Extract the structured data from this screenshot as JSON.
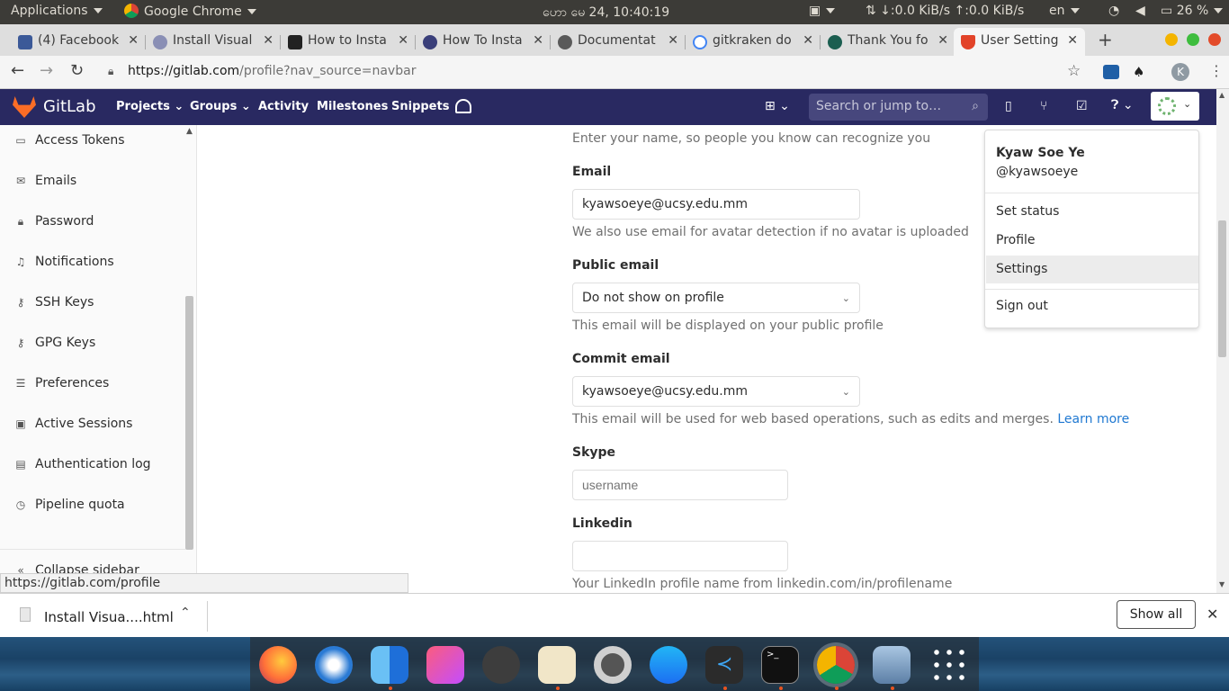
{
  "os_bar": {
    "applications": "Applications",
    "active_app": "Google Chrome",
    "clock": "ဟော မေ 24, 10:40:19",
    "network": "⇅ ↓:0.0 KiB/s ↑:0.0 KiB/s",
    "language": "en",
    "battery": "26 %"
  },
  "browser": {
    "tabs": [
      {
        "label": "(4) Facebook",
        "color": "#3b5998"
      },
      {
        "label": "Install Visual",
        "color": "#8a8fb5"
      },
      {
        "label": "How to Insta",
        "color": "#222222"
      },
      {
        "label": "How To Insta",
        "color": "#3a3f7a"
      },
      {
        "label": "Documentat",
        "color": "#5a5a5a"
      },
      {
        "label": "gitkraken do",
        "color": "#4285f4"
      },
      {
        "label": "Thank You fo",
        "color": "#1b5e50"
      },
      {
        "label": "User Setting",
        "color": "#e24329"
      }
    ],
    "url_host": "https://gitlab.com",
    "url_path": "/profile?nav_source=navbar",
    "profile_initial": "K"
  },
  "gitlab_header": {
    "brand": "GitLab",
    "nav": [
      "Projects",
      "Groups",
      "Activity",
      "Milestones",
      "Snippets"
    ],
    "search_placeholder": "Search or jump to…"
  },
  "sidebar": {
    "items": [
      {
        "label": "Access Tokens",
        "icon": "token-icon"
      },
      {
        "label": "Emails",
        "icon": "mail-icon"
      },
      {
        "label": "Password",
        "icon": "lock-icon"
      },
      {
        "label": "Notifications",
        "icon": "bell-icon"
      },
      {
        "label": "SSH Keys",
        "icon": "key-icon"
      },
      {
        "label": "GPG Keys",
        "icon": "key-icon"
      },
      {
        "label": "Preferences",
        "icon": "sliders-icon"
      },
      {
        "label": "Active Sessions",
        "icon": "monitor-icon"
      },
      {
        "label": "Authentication log",
        "icon": "log-icon"
      },
      {
        "label": "Pipeline quota",
        "icon": "quota-icon"
      }
    ],
    "collapse": "Collapse sidebar"
  },
  "form": {
    "name_help": "Enter your name, so people you know can recognize you",
    "email_label": "Email",
    "email_value": "kyawsoeye@ucsy.edu.mm",
    "email_help": "We also use email for avatar detection if no avatar is uploaded",
    "public_email_label": "Public email",
    "public_email_value": "Do not show on profile",
    "public_email_help": "This email will be displayed on your public profile",
    "commit_email_label": "Commit email",
    "commit_email_value": "kyawsoeye@ucsy.edu.mm",
    "commit_email_help": "This email will be used for web based operations, such as edits and merges.",
    "learn_more": "Learn more",
    "skype_label": "Skype",
    "skype_placeholder": "username",
    "linkedin_label": "Linkedin",
    "linkedin_help": "Your LinkedIn profile name from linkedin.com/in/profilename"
  },
  "user_menu": {
    "name": "Kyaw Soe Ye",
    "handle": "@kyawsoeye",
    "items": [
      "Set status",
      "Profile",
      "Settings",
      "Sign out"
    ]
  },
  "status_url": "https://gitlab.com/profile",
  "downloads": {
    "file": "Install Visua....html",
    "show_all": "Show all"
  }
}
